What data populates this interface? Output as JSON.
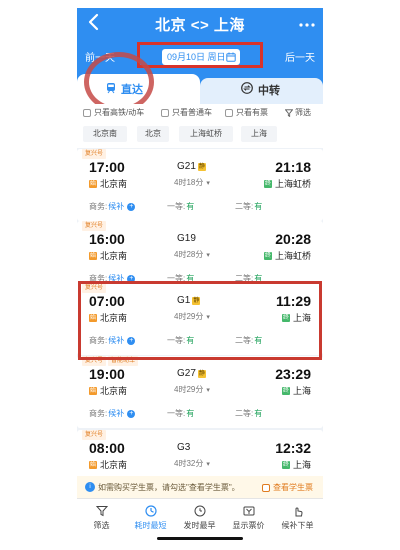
{
  "header": {
    "title": "北京 <> 上海",
    "prev_day": "前一天",
    "next_day": "后一天",
    "date": "09月10日 周日"
  },
  "tabs": {
    "direct": "直达",
    "transfer": "中转"
  },
  "filters": {
    "gd_only": "只看高铁/动车",
    "normal_only": "只看普通车",
    "has_ticket": "只看有票",
    "filter": "筛选"
  },
  "stations": [
    "北京南",
    "北京",
    "上海虹桥",
    "上海"
  ],
  "trains": [
    {
      "badges": [
        "复兴号"
      ],
      "dep_time": "17:00",
      "arr_time": "21:18",
      "number": "G21",
      "tag": "静",
      "duration": "4时18分",
      "dep_station": "北京南",
      "arr_station": "上海虹桥",
      "seats": [
        {
          "label": "商务:",
          "status": "候补",
          "kind": "wait"
        },
        {
          "label": "一等:",
          "status": "有",
          "kind": "avail"
        },
        {
          "label": "二等:",
          "status": "有",
          "kind": "avail"
        }
      ]
    },
    {
      "badges": [
        "复兴号"
      ],
      "dep_time": "16:00",
      "arr_time": "20:28",
      "number": "G19",
      "tag": "",
      "duration": "4时28分",
      "dep_station": "北京南",
      "arr_station": "上海虹桥",
      "seats": [
        {
          "label": "商务:",
          "status": "候补",
          "kind": "wait"
        },
        {
          "label": "一等:",
          "status": "有",
          "kind": "avail"
        },
        {
          "label": "二等:",
          "status": "有",
          "kind": "avail"
        }
      ]
    },
    {
      "badges": [
        "复兴号"
      ],
      "dep_time": "07:00",
      "arr_time": "11:29",
      "number": "G1",
      "tag": "静",
      "duration": "4时29分",
      "dep_station": "北京南",
      "arr_station": "上海",
      "seats": [
        {
          "label": "商务:",
          "status": "候补",
          "kind": "wait"
        },
        {
          "label": "一等:",
          "status": "有",
          "kind": "avail"
        },
        {
          "label": "二等:",
          "status": "有",
          "kind": "avail"
        }
      ]
    },
    {
      "badges": [
        "复兴号",
        "智能动车"
      ],
      "dep_time": "19:00",
      "arr_time": "23:29",
      "number": "G27",
      "tag": "静",
      "duration": "4时29分",
      "dep_station": "北京南",
      "arr_station": "上海",
      "seats": [
        {
          "label": "商务:",
          "status": "候补",
          "kind": "wait"
        },
        {
          "label": "一等:",
          "status": "有",
          "kind": "avail"
        },
        {
          "label": "二等:",
          "status": "有",
          "kind": "avail"
        }
      ]
    },
    {
      "badges": [
        "复兴号"
      ],
      "dep_time": "08:00",
      "arr_time": "12:32",
      "number": "G3",
      "tag": "",
      "duration": "4时32分",
      "dep_station": "北京南",
      "arr_station": "上海",
      "seats": []
    }
  ],
  "notice": {
    "text": "如需购买学生票，请勾选\"查看学生票\"。",
    "check": "查看学生票"
  },
  "bottom_bar": {
    "items": [
      "筛选",
      "耗时最短",
      "发时最早",
      "显示票价",
      "候补下单"
    ]
  },
  "station_icons": {
    "start": "始",
    "end": "终"
  },
  "colors": {
    "brand": "#2f8ef1",
    "available": "#1ea15a",
    "annotation": "#c93a30"
  }
}
